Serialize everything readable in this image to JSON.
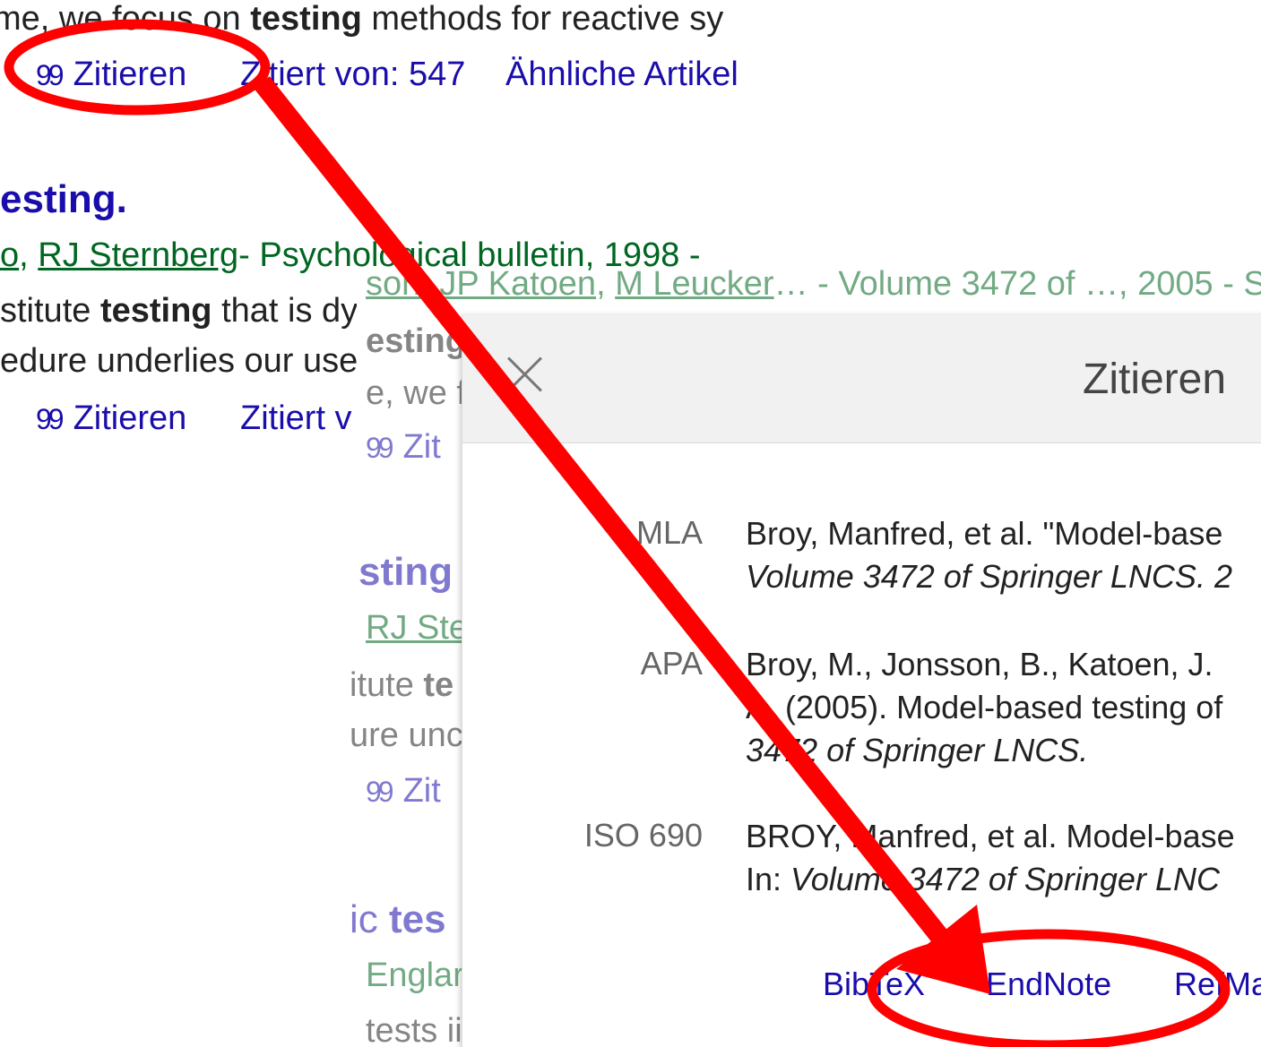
{
  "result1": {
    "snippet_start": "me, we focus on",
    "snippet_bold": "testing",
    "snippet_end": "methods for reactive sy",
    "cite_label": "Zitieren",
    "cited_by": "Zitiert von: 547",
    "related": "Ähnliche Artikel"
  },
  "result2": {
    "title": "esting.",
    "author1": "o",
    "author2": "RJ Sternberg",
    "source": "- Psychological bulletin, 1998 - ",
    "line1_start": "stitute",
    "line1_bold": "testing",
    "line1_end": "that is dy",
    "line2": "edure underlies our use",
    "cite_label": "Zitieren",
    "cited_by": "Zitiert v"
  },
  "background2": {
    "authors_a": "son",
    "authors_b": "JP Katoen",
    "authors_c": "M Leucker",
    "authors_rest": "… - Volume 3472 of …, 2005 - S",
    "title_frag": "esting",
    "snippet_frag": "e, we f",
    "cite_frag": "Zit",
    "title2_frag": "sting",
    "author2_frag": "RJ Ste",
    "line_a_start": "itute",
    "line_a_bold": "te",
    "line_b": "ure unc",
    "cite2_frag": "Zit",
    "title3_start": "ic",
    "title3_bold": "tes",
    "source3_frag": "Englar",
    "line3": "tests ii"
  },
  "modal": {
    "title": "Zitieren",
    "citations": [
      {
        "format": "MLA",
        "lines": [
          "Broy, Manfred, et al. \"Model-base"
        ],
        "italic": "Volume 3472 of Springer LNCS. 2"
      },
      {
        "format": "APA",
        "lines": [
          "Broy, M., Jonsson, B., Katoen, J.",
          "A. (2005). Model-based testing of"
        ],
        "italic": "3472 of Springer LNCS."
      },
      {
        "format": "ISO 690",
        "lines": [
          "BROY, Manfred, et al. Model-base"
        ],
        "prefix": "In: ",
        "italic": "Volume 3472 of Springer LNC"
      }
    ],
    "exports": [
      "BibTeX",
      "EndNote",
      "RefMa"
    ]
  },
  "annotation": {
    "color": "#ff0000"
  }
}
